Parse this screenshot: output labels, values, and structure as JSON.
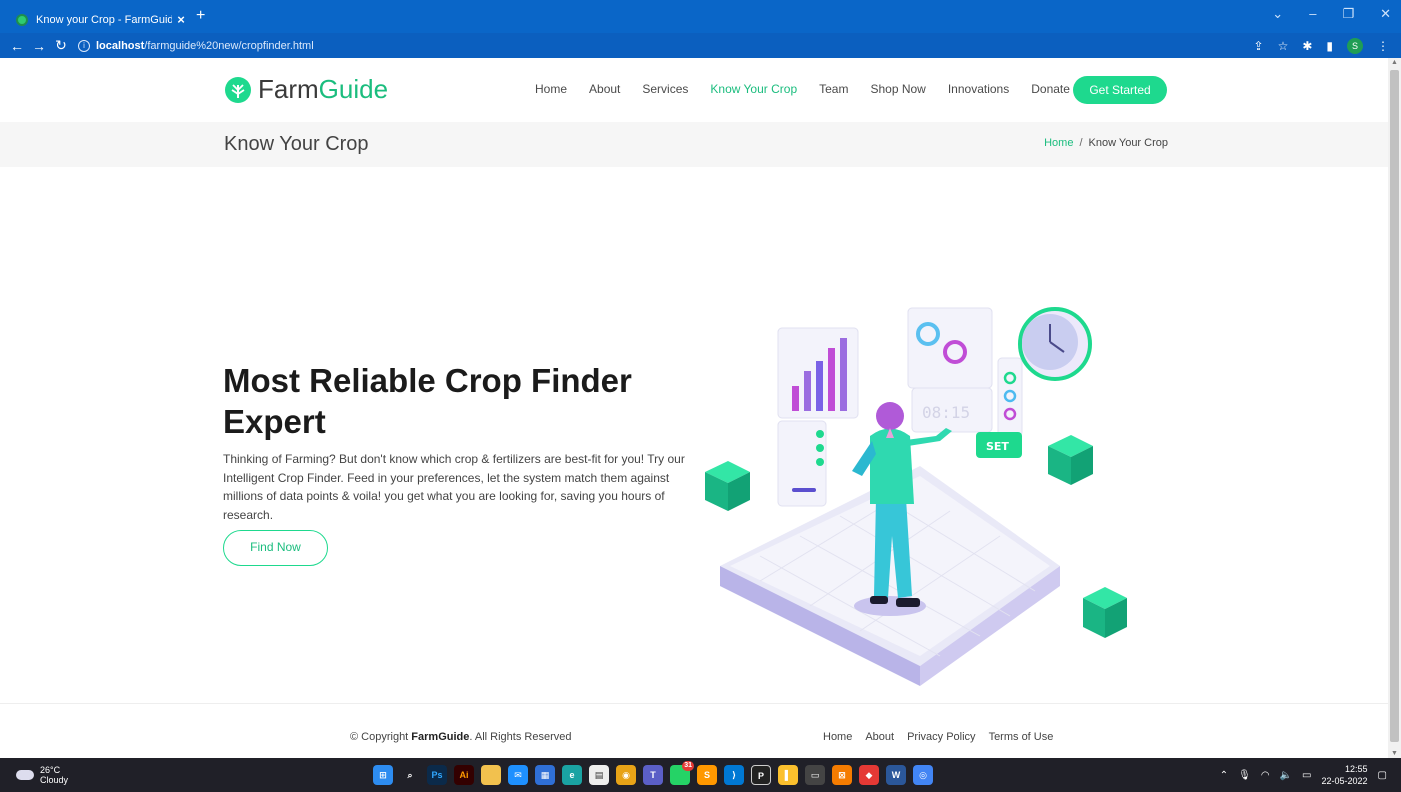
{
  "browser": {
    "tab_title": "Know your Crop - FarmGuide",
    "tab_close": "×",
    "new_tab": "+",
    "url_host": "localhost",
    "url_path": "/farmguide%20new/cropfinder.html",
    "profile_initial": "S"
  },
  "header": {
    "logo_main": "Farm",
    "logo_accent": "Guide",
    "menu": [
      "Home",
      "About",
      "Services",
      "Know Your Crop",
      "Team",
      "Shop Now",
      "Innovations",
      "Donate"
    ],
    "active_menu": "Know Your Crop",
    "cta_label": "Get Started"
  },
  "breadcrumb": {
    "page_title": "Know Your Crop",
    "home": "Home",
    "separator": "/",
    "current": "Know Your Crop"
  },
  "hero": {
    "title": "Most Reliable Crop Finder Expert",
    "text": "Thinking of Farming? But don't know which crop & fertilizers are best-fit for you! Try our Intelligent Crop Finder. Feed in your preferences, let the system match them against millions of data points & voila! you get what you are looking for, saving you hours of research.",
    "button_label": "Find Now",
    "illustration_clock_text": "08:15",
    "illustration_set_text": "SET"
  },
  "footer": {
    "copyright_prefix": "© Copyright ",
    "copyright_brand": "FarmGuide",
    "copyright_suffix": ". All Rights Reserved",
    "links": [
      "Home",
      "About",
      "Privacy Policy",
      "Terms of Use"
    ]
  },
  "taskbar": {
    "temperature": "26°C",
    "weather": "Cloudy",
    "time": "12:55",
    "date": "22-05-2022",
    "badge_count": "31"
  },
  "colors": {
    "accent": "#1ed98e",
    "accent_text": "#1bbd7e",
    "chrome_blue": "#0a66c8"
  }
}
